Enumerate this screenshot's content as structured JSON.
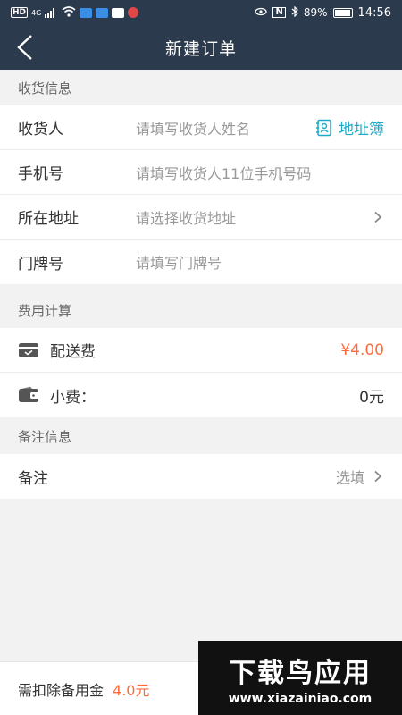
{
  "statusbar": {
    "network": "HD",
    "network_gen": "4G",
    "battery": "89%",
    "time": "14:56",
    "nfc": "N"
  },
  "navbar": {
    "title": "新建订单"
  },
  "receiver_section": {
    "title": "收货信息",
    "rows": [
      {
        "label": "收货人",
        "placeholder": "请填写收货人姓名",
        "action": "地址簿"
      },
      {
        "label": "手机号",
        "placeholder": "请填写收货人11位手机号码"
      },
      {
        "label": "所在地址",
        "placeholder": "请选择收货地址"
      },
      {
        "label": "门牌号",
        "placeholder": "请填写门牌号"
      }
    ]
  },
  "fee_section": {
    "title": "费用计算",
    "delivery_label": "配送费",
    "delivery_value": "¥4.00",
    "tip_label": "小费：",
    "tip_value": "0元"
  },
  "remark_section": {
    "title": "备注信息",
    "label": "备注",
    "value": "选填"
  },
  "bottom": {
    "label": "需扣除备用金",
    "amount": "4.0元"
  },
  "watermark": {
    "line1": "下载鸟应用",
    "line2": "www.xiazainiao.com"
  },
  "colors": {
    "nav_bg": "#2c3a4d",
    "accent_teal": "#20a9c8",
    "price_red": "#ff6b3d"
  }
}
